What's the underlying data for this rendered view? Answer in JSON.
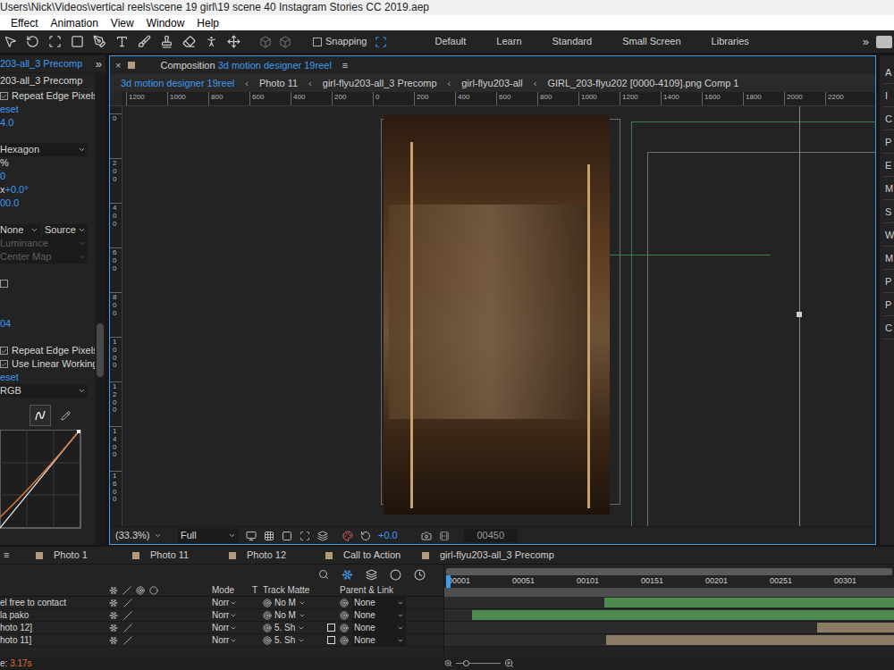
{
  "title_bar": {
    "path": "Users\\Nick\\Videos\\vertical reels\\scene 19 girl\\19 scene 40 Instagram Stories CC 2019.aep"
  },
  "menu": [
    "Effect",
    "Animation",
    "View",
    "Window",
    "Help"
  ],
  "toolbar": {
    "snapping": {
      "label": "Snapping",
      "checked": false
    },
    "workspaces": [
      {
        "label": "Default",
        "selected": false
      },
      {
        "label": "Learn",
        "selected": false
      },
      {
        "label": "Standard",
        "selected": false
      },
      {
        "label": "Small Screen",
        "selected": false
      },
      {
        "label": "Libraries",
        "selected": false
      }
    ],
    "more": "»"
  },
  "effect_controls": {
    "tab": "203-all_3 Precomp",
    "more": "»",
    "layer": "203-all_3 Precomp",
    "rows": [
      {
        "kind": "checkbox",
        "label": "Repeat Edge Pixels",
        "checked": true
      },
      {
        "kind": "link",
        "label": "eset"
      },
      {
        "kind": "value",
        "label": "4.0"
      },
      {
        "kind": "blank"
      },
      {
        "kind": "dropdown",
        "label": "Hexagon",
        "disabled": false
      },
      {
        "kind": "text",
        "label": "%"
      },
      {
        "kind": "value",
        "label": "0"
      },
      {
        "kind": "angle",
        "prefix": "x",
        "label": "+0.0°"
      },
      {
        "kind": "value",
        "label": "00.0"
      },
      {
        "kind": "blank"
      },
      {
        "kind": "dual",
        "label": "None",
        "label2": "Source"
      },
      {
        "kind": "dropdown",
        "label": "Luminance",
        "disabled": true
      },
      {
        "kind": "dropdown",
        "label": "Center Map",
        "disabled": true
      },
      {
        "kind": "blank"
      },
      {
        "kind": "checkbox",
        "label": "",
        "checked": false
      },
      {
        "kind": "blank"
      },
      {
        "kind": "blank"
      },
      {
        "kind": "value",
        "label": "04"
      },
      {
        "kind": "blank"
      },
      {
        "kind": "checkbox",
        "label": "Repeat Edge Pixels",
        "checked": true
      },
      {
        "kind": "checkbox",
        "label": "Use Linear Working",
        "checked": true
      },
      {
        "kind": "link",
        "label": "eset"
      },
      {
        "kind": "dropdown",
        "label": "RGB",
        "disabled": false
      }
    ]
  },
  "composition": {
    "close": "×",
    "label": "Composition",
    "name": "3d motion designer 19reel",
    "menu": "≡",
    "separator": "‹",
    "breadcrumbs": [
      {
        "label": "3d motion designer 19reel",
        "selected": true
      },
      {
        "label": "Photo 11",
        "selected": false
      },
      {
        "label": "girl-flyu203-all_3 Precomp",
        "selected": false
      },
      {
        "label": "girl-flyu203-all",
        "selected": false
      },
      {
        "label": "GIRL_203-flyu202 [0000-4109].png Comp 1",
        "selected": false
      }
    ],
    "ruler_h": [
      "1200",
      "1000",
      "800",
      "600",
      "400",
      "200",
      "0",
      "200",
      "400",
      "600",
      "800",
      "1000",
      "1200",
      "1400",
      "1600",
      "1800",
      "2000",
      "2200"
    ],
    "ruler_v": [
      "0",
      "200",
      "400",
      "600",
      "800",
      "1000",
      "1200",
      "1400",
      "1600"
    ],
    "footer": {
      "zoom": "(33.3%)",
      "resolution": "Full",
      "exposure": "+0.0",
      "timecode": "00450"
    }
  },
  "right_panel": {
    "letters": [
      "A",
      "I",
      "C",
      "P",
      "E",
      "M",
      "S",
      "W",
      "M",
      "P",
      "P",
      "C"
    ]
  },
  "timeline": {
    "menu": "≡",
    "tabs": [
      {
        "label": "Photo 1",
        "selected": false
      },
      {
        "label": "Photo 11",
        "selected": false
      },
      {
        "label": "Photo 12",
        "selected": false
      },
      {
        "label": "Call to Action",
        "selected": false
      },
      {
        "label": "girl-flyu203-all_3 Precomp",
        "selected": false
      }
    ],
    "columns": {
      "mode": "Mode",
      "t": "T",
      "track_matte": "Track Matte",
      "parent": "Parent & Link"
    },
    "ticks": [
      "00001",
      "00051",
      "00101",
      "00151",
      "00201",
      "00251",
      "00301"
    ],
    "layers": [
      {
        "name": "el free to contact",
        "mode": "Norr",
        "track_matte": "No M",
        "matte_box": false,
        "parent": "None",
        "start": 0.356,
        "end": 1,
        "color": "#4d8a4d"
      },
      {
        "name": "la pako",
        "mode": "Norr",
        "track_matte": "No M",
        "matte_box": false,
        "parent": "None",
        "start": 0.062,
        "end": 1,
        "color": "#4d8a4d"
      },
      {
        "name": "hoto 12]",
        "mode": "Norr",
        "track_matte": "5. Sh",
        "matte_box": true,
        "parent": "None",
        "start": 0.83,
        "end": 1,
        "color": "#8c7b65"
      },
      {
        "name": "hoto 11]",
        "mode": "Norr",
        "track_matte": "5. Sh",
        "matte_box": true,
        "parent": "None",
        "start": 0.36,
        "end": 1,
        "color": "#8c7b65"
      }
    ],
    "status": {
      "label": "e:",
      "value": "3.17s"
    }
  }
}
